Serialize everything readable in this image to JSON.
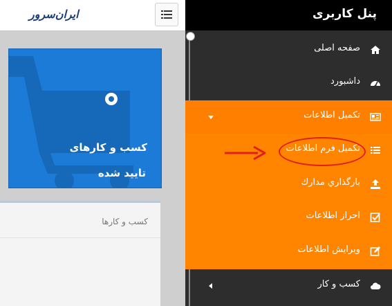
{
  "header": {
    "logo_text": "ایران‌سرور",
    "menu_button_icon": "hamburger-list-icon"
  },
  "tile": {
    "line1": "کسب و کارهای",
    "line2": "تایید شده",
    "icon": "shopping-cart-icon",
    "color": "#1b7bd6"
  },
  "panel": {
    "title": "کسب و کارها"
  },
  "sidebar": {
    "title": "پنل کاربری",
    "items": [
      {
        "label": "صفحه اصلی",
        "icon": "home-icon"
      },
      {
        "label": "داشبورد",
        "icon": "dashboard-gauge-icon"
      },
      {
        "label": "تکمیل اطلاعات",
        "icon": "id-card-icon",
        "expanded": true
      },
      {
        "label": "تکمیل فرم اطلاعات",
        "icon": "list-icon",
        "highlighted": true
      },
      {
        "label": "بارگذاري مدارك",
        "icon": "upload-icon"
      },
      {
        "label": "احراز اطلاعات",
        "icon": "checkbox-icon"
      },
      {
        "label": "ويرايش اطلاعات",
        "icon": "edit-icon"
      },
      {
        "label": "کسب و کار",
        "icon": "cloud-icon",
        "expanded": false
      }
    ],
    "accent_color": "#ff8500",
    "background_color": "#2d2d2d"
  }
}
